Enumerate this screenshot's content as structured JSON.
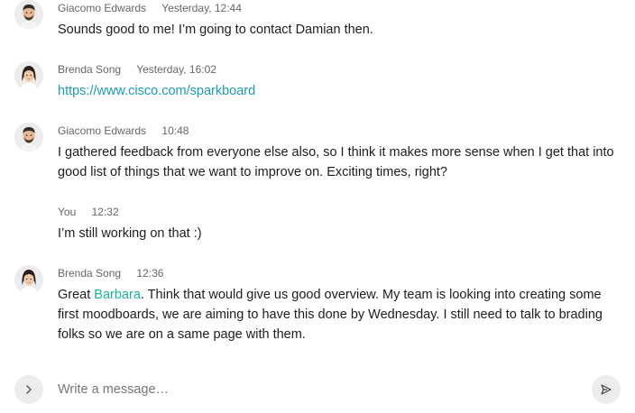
{
  "messages": [
    {
      "sender": "Giacomo Edwards",
      "time": "Yesterday, 12:44",
      "avatar": "male-avatar",
      "text": "Sounds good to me! I’m going to contact Damian then."
    },
    {
      "sender": "Brenda Song",
      "time": "Yesterday, 16:02",
      "avatar": "female-avatar",
      "link": "https://www.cisco.com/sparkboard"
    },
    {
      "sender": "Giacomo Edwards",
      "time": "10:48",
      "avatar": "male-avatar",
      "text": "I gathered feedback from everyone else also, so I think it makes more sense when I get that into good list of things that we want to improve on. Exciting times, right?"
    },
    {
      "sender": "You",
      "time": "12:32",
      "text": "I’m still working on that :)"
    },
    {
      "sender": "Brenda Song",
      "time": "12:36",
      "avatar": "female-avatar",
      "text_before": "Great ",
      "mention": "Barbara",
      "text_after": ". Think that would give us good overview. My team is looking into creating some first moodboards, we are aiming to have this done by Wednesday. I still need to talk to brading folks so we are on a same page with them."
    }
  ],
  "composer": {
    "placeholder": "Write a message…",
    "expand_icon": "chevron-right-icon",
    "send_icon": "send-icon"
  },
  "colors": {
    "link": "#1b9bb5",
    "mention": "#1bb39a",
    "meta": "#666666",
    "button_bg": "#ededed"
  }
}
